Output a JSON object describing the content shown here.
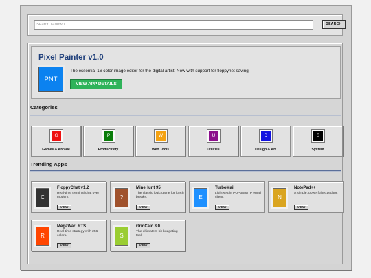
{
  "search": {
    "placeholder": "Search is down...",
    "button_label": "SEARCH"
  },
  "featured": {
    "title": "Pixel Painter v1.0",
    "icon_text": "PNT",
    "icon_color": "#0b82f0",
    "description": "The essential 16-color image editor for the digital artist. Now with support for floppynet saving!",
    "button_label": "VIEW APP DETAILS",
    "button_color": "#2fb35a"
  },
  "categories": {
    "heading": "Categories",
    "items": [
      {
        "letter": "G",
        "label": "Games & Arcade",
        "color": "#ee1111"
      },
      {
        "letter": "P",
        "label": "Productivity",
        "color": "#0a7d0a"
      },
      {
        "letter": "W",
        "label": "Web Tools",
        "color": "#f5a211"
      },
      {
        "letter": "U",
        "label": "Utilities",
        "color": "#8c0f8c"
      },
      {
        "letter": "D",
        "label": "Design & Art",
        "color": "#1212e0"
      },
      {
        "letter": "S",
        "label": "System",
        "color": "#000000"
      }
    ]
  },
  "trending": {
    "heading": "Trending Apps",
    "view_label": "VIEW",
    "items": [
      {
        "letter": "C",
        "name": "FloppyChat v1.2",
        "description": "Real-time terminal chat over modem.",
        "color": "#333333"
      },
      {
        "letter": "?",
        "name": "MineHunt 95",
        "description": "The classic logic game for lunch breaks.",
        "color": "#a0522d"
      },
      {
        "letter": "E",
        "name": "TurboMail",
        "description": "Lightweight POP3/SMTP email client.",
        "color": "#1e90ff"
      },
      {
        "letter": "N",
        "name": "NotePad++",
        "description": "A simple, powerful text editor.",
        "color": "#daa520"
      },
      {
        "letter": "R",
        "name": "MegaWar! RTS",
        "description": "Real-time strategy with 256 colors.",
        "color": "#ff4500"
      },
      {
        "letter": "S",
        "name": "GridCalc 3.0",
        "description": "The ultimate 8-bit budgeting tool.",
        "color": "#9acd32"
      }
    ]
  }
}
